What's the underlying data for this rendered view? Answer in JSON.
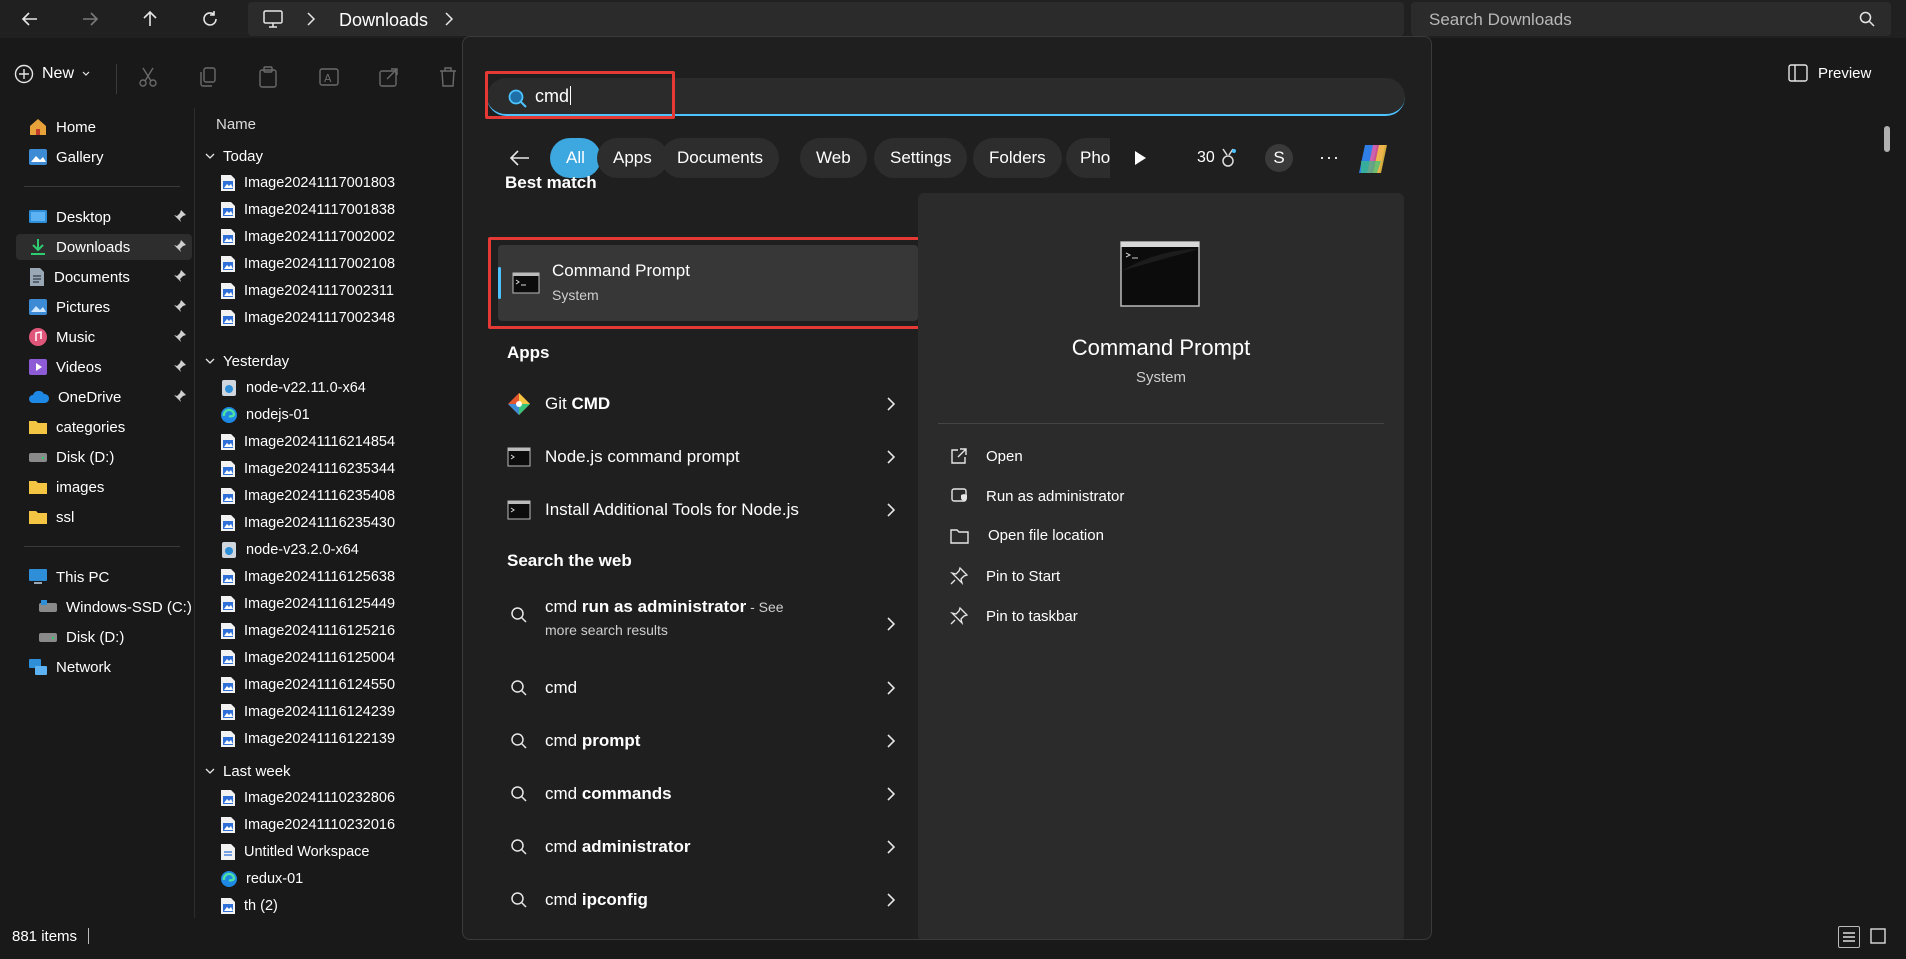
{
  "explorer": {
    "breadcrumb": [
      "Downloads"
    ],
    "search_placeholder": "Search Downloads",
    "new_label": "New",
    "preview_label": "Preview",
    "column_name": "Name",
    "status_count": "881 items",
    "nav": {
      "quick": [
        {
          "label": "Home",
          "icon": "home-icon"
        },
        {
          "label": "Gallery",
          "icon": "gallery-icon"
        }
      ],
      "pinned": [
        {
          "label": "Desktop",
          "icon": "desktop-folder-icon",
          "pinned": true
        },
        {
          "label": "Downloads",
          "icon": "downloads-folder-icon",
          "pinned": true,
          "selected": true
        },
        {
          "label": "Documents",
          "icon": "documents-folder-icon",
          "pinned": true
        },
        {
          "label": "Pictures",
          "icon": "pictures-folder-icon",
          "pinned": true
        },
        {
          "label": "Music",
          "icon": "music-folder-icon",
          "pinned": true
        },
        {
          "label": "Videos",
          "icon": "videos-folder-icon",
          "pinned": true
        },
        {
          "label": "OneDrive",
          "icon": "onedrive-icon",
          "pinned": true
        },
        {
          "label": "categories",
          "icon": "folder-icon"
        },
        {
          "label": "Disk (D:)",
          "icon": "drive-icon"
        },
        {
          "label": "images",
          "icon": "folder-icon"
        },
        {
          "label": "ssl",
          "icon": "folder-icon"
        }
      ],
      "this_pc": "This PC",
      "drives": [
        "Windows-SSD (C:)",
        "Disk (D:)"
      ],
      "network": "Network"
    },
    "groups": [
      {
        "label": "Today",
        "files": [
          {
            "name": "Image20241117001803",
            "type": "image"
          },
          {
            "name": "Image20241117001838",
            "type": "image"
          },
          {
            "name": "Image20241117002002",
            "type": "image"
          },
          {
            "name": "Image20241117002108",
            "type": "image"
          },
          {
            "name": "Image20241117002311",
            "type": "image"
          },
          {
            "name": "Image20241117002348",
            "type": "image"
          }
        ]
      },
      {
        "label": "Yesterday",
        "files": [
          {
            "name": "node-v22.11.0-x64",
            "type": "installer"
          },
          {
            "name": "nodejs-01",
            "type": "edge"
          },
          {
            "name": "Image20241116214854",
            "type": "image"
          },
          {
            "name": "Image20241116235344",
            "type": "image"
          },
          {
            "name": "Image20241116235408",
            "type": "image"
          },
          {
            "name": "Image20241116235430",
            "type": "image"
          },
          {
            "name": "node-v23.2.0-x64",
            "type": "installer"
          },
          {
            "name": "Image20241116125638",
            "type": "image"
          },
          {
            "name": "Image20241116125449",
            "type": "image"
          },
          {
            "name": "Image20241116125216",
            "type": "image"
          },
          {
            "name": "Image20241116125004",
            "type": "image"
          },
          {
            "name": "Image20241116124550",
            "type": "image"
          },
          {
            "name": "Image20241116124239",
            "type": "image"
          },
          {
            "name": "Image20241116122139",
            "type": "image"
          }
        ]
      },
      {
        "label": "Last week",
        "files": [
          {
            "name": "Image20241110232806",
            "type": "image"
          },
          {
            "name": "Image20241110232016",
            "type": "image"
          },
          {
            "name": "Untitled Workspace",
            "type": "doc"
          },
          {
            "name": "redux-01",
            "type": "edge"
          },
          {
            "name": "th (2)",
            "type": "image"
          }
        ]
      }
    ]
  },
  "search": {
    "query": "cmd",
    "filters": [
      "All",
      "Apps",
      "Documents",
      "Web",
      "Settings",
      "Folders",
      "Pho"
    ],
    "active_filter": "All",
    "points": "30",
    "avatar_letter": "S",
    "best_match_heading": "Best match",
    "best_match": {
      "title": "Command Prompt",
      "subtitle": "System"
    },
    "apps_heading": "Apps",
    "apps": [
      {
        "prefix": "Git ",
        "bold": "CMD",
        "icon": "git-icon"
      },
      {
        "label": "Node.js command prompt",
        "icon": "console-icon"
      },
      {
        "label": "Install Additional Tools for Node.js",
        "icon": "console-icon"
      }
    ],
    "web_heading": "Search the web",
    "web": [
      {
        "prefix": "cmd ",
        "bold": "run as administrator",
        "suffix": " - See",
        "line2": "more search results"
      },
      {
        "prefix": "cmd",
        "bold": "",
        "suffix": ""
      },
      {
        "prefix": "cmd ",
        "bold": "prompt",
        "suffix": ""
      },
      {
        "prefix": "cmd ",
        "bold": "commands",
        "suffix": ""
      },
      {
        "prefix": "cmd ",
        "bold": "administrator",
        "suffix": ""
      },
      {
        "prefix": "cmd ",
        "bold": "ipconfig",
        "suffix": ""
      }
    ],
    "detail": {
      "title": "Command Prompt",
      "subtitle": "System",
      "actions": [
        {
          "label": "Open",
          "icon": "open-external-icon"
        },
        {
          "label": "Run as administrator",
          "icon": "shield-admin-icon"
        },
        {
          "label": "Open file location",
          "icon": "folder-open-icon"
        },
        {
          "label": "Pin to Start",
          "icon": "pin-icon"
        },
        {
          "label": "Pin to taskbar",
          "icon": "pin-icon"
        }
      ]
    }
  },
  "colors": {
    "accent": "#4cc2ff",
    "active_pill": "#3da7e0",
    "highlight_box": "#e53935",
    "background": "#191919",
    "panel": "#2b2b2b"
  }
}
